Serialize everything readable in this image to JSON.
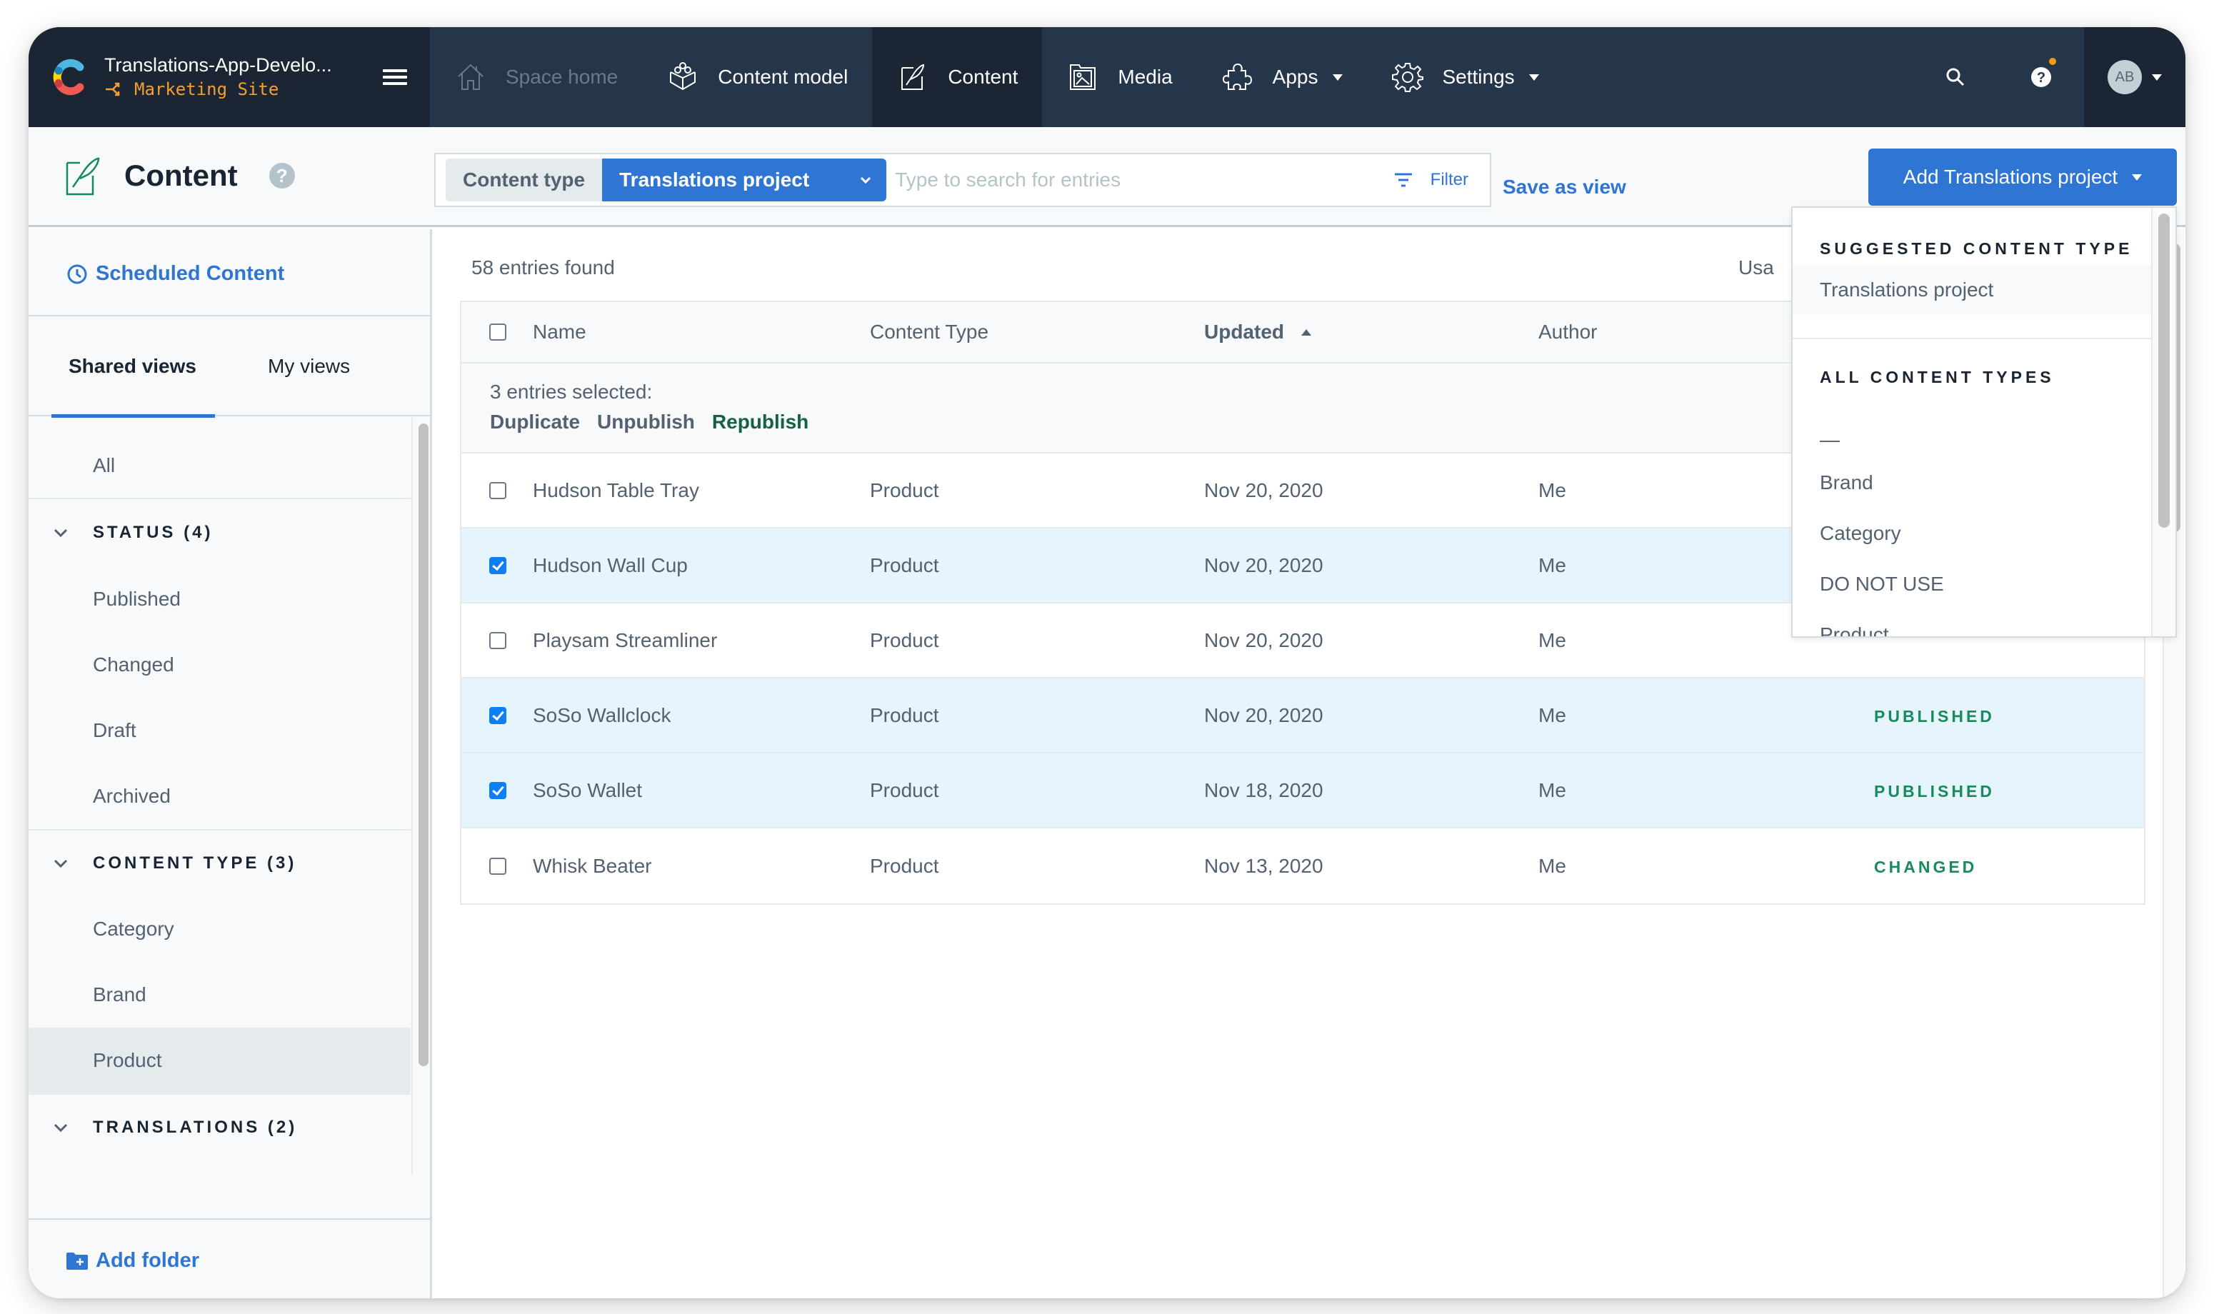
{
  "topnav": {
    "space_name": "Translations-App-Develo...",
    "environment": "Marketing Site",
    "items": [
      {
        "label": "Space home",
        "icon": "home-icon",
        "state": "disabled"
      },
      {
        "label": "Content model",
        "icon": "content-model-icon",
        "state": "normal"
      },
      {
        "label": "Content",
        "icon": "content-icon",
        "state": "active"
      },
      {
        "label": "Media",
        "icon": "media-icon",
        "state": "normal"
      },
      {
        "label": "Apps",
        "icon": "puzzle-icon",
        "state": "normal",
        "has_dropdown": true
      },
      {
        "label": "Settings",
        "icon": "gear-icon",
        "state": "normal",
        "has_dropdown": true
      }
    ],
    "avatar_initials": "AB"
  },
  "header": {
    "title": "Content",
    "content_type_label": "Content type",
    "content_type_value": "Translations project",
    "search_placeholder": "Type to search for entries",
    "search_value": "",
    "filter_label": "Filter",
    "save_view_label": "Save as view",
    "add_button_label": "Add Translations project"
  },
  "sidebar": {
    "scheduled_label": "Scheduled Content",
    "tabs": [
      {
        "label": "Shared views",
        "active": true
      },
      {
        "label": "My views",
        "active": false
      }
    ],
    "all_label": "All",
    "folders": [
      {
        "label": "STATUS (4)",
        "items": [
          "Published",
          "Changed",
          "Draft",
          "Archived"
        ]
      },
      {
        "label": "CONTENT TYPE (3)",
        "items": [
          "Category",
          "Brand",
          "Product"
        ],
        "selected": "Product"
      },
      {
        "label": "TRANSLATIONS (2)",
        "items": []
      }
    ],
    "add_folder_label": "Add folder"
  },
  "main": {
    "entries_found": "58 entries found",
    "usage_stub": "Usa",
    "columns": [
      "Name",
      "Content Type",
      "Updated",
      "Author"
    ],
    "sort_column": "Updated",
    "bulk": {
      "count_text": "3 entries selected:",
      "actions": [
        "Duplicate",
        "Unpublish",
        "Republish"
      ]
    },
    "rows": [
      {
        "name": "Hudson Table Tray",
        "content_type": "Product",
        "updated": "Nov 20, 2020",
        "author": "Me",
        "status": "",
        "checked": false
      },
      {
        "name": "Hudson Wall Cup",
        "content_type": "Product",
        "updated": "Nov 20, 2020",
        "author": "Me",
        "status": "",
        "checked": true
      },
      {
        "name": "Playsam Streamliner",
        "content_type": "Product",
        "updated": "Nov 20, 2020",
        "author": "Me",
        "status": "",
        "checked": false
      },
      {
        "name": "SoSo Wallclock",
        "content_type": "Product",
        "updated": "Nov 20, 2020",
        "author": "Me",
        "status": "PUBLISHED",
        "checked": true
      },
      {
        "name": "SoSo Wallet",
        "content_type": "Product",
        "updated": "Nov 18, 2020",
        "author": "Me",
        "status": "PUBLISHED",
        "checked": true
      },
      {
        "name": "Whisk Beater",
        "content_type": "Product",
        "updated": "Nov 13, 2020",
        "author": "Me",
        "status": "CHANGED",
        "checked": false
      }
    ]
  },
  "dropdown": {
    "suggested_heading": "SUGGESTED CONTENT TYPE",
    "suggested_items": [
      "Translations project"
    ],
    "all_heading": "ALL CONTENT TYPES",
    "all_items": [
      "—",
      "Brand",
      "Category",
      "DO NOT USE",
      "Product"
    ]
  },
  "colors": {
    "nav_bg": "#25354a",
    "nav_dark": "#1b2533",
    "accent_blue": "#2e75d4",
    "env_orange": "#f4a031",
    "status_green": "#1a8a5a",
    "selected_row": "#e6f4fe"
  }
}
